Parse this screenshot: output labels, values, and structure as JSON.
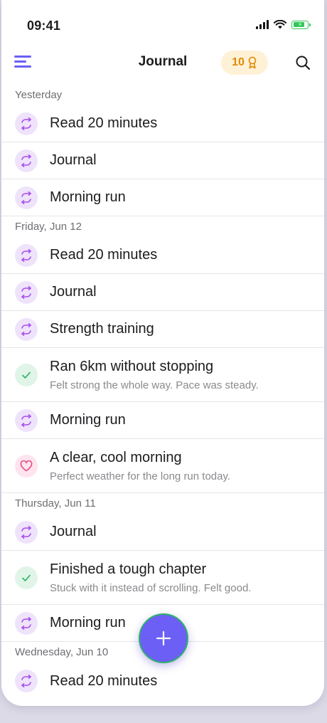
{
  "status_bar": {
    "time": "09:41",
    "battery_level": 0.8,
    "battery_color": "#34c759"
  },
  "header": {
    "title": "Journal",
    "points": "10",
    "accent_color": "#6b5ff5",
    "icons": {
      "menu": "hamburger-menu-icon",
      "points": "award-ribbon-icon",
      "search": "search-icon"
    }
  },
  "sections": [
    {
      "label": "Yesterday",
      "entries": [
        {
          "type": "habit",
          "title": "Read 20 minutes"
        },
        {
          "type": "habit",
          "title": "Journal"
        },
        {
          "type": "habit",
          "title": "Morning run"
        }
      ]
    },
    {
      "label": "Friday, Jun 12",
      "entries": [
        {
          "type": "habit",
          "title": "Read 20 minutes"
        },
        {
          "type": "habit",
          "title": "Journal"
        },
        {
          "type": "habit",
          "title": "Strength training"
        },
        {
          "type": "win",
          "title": "Ran 6km without stopping",
          "subtitle": "Felt strong the whole way. Pace was steady."
        },
        {
          "type": "habit",
          "title": "Morning run"
        },
        {
          "type": "grateful",
          "title": "A clear, cool morning",
          "subtitle": "Perfect weather for the long run today."
        }
      ]
    },
    {
      "label": "Thursday, Jun 11",
      "entries": [
        {
          "type": "habit",
          "title": "Journal"
        },
        {
          "type": "win",
          "title": "Finished a tough chapter",
          "subtitle": "Stuck with it instead of scrolling. Felt good."
        },
        {
          "type": "habit",
          "title": "Morning run"
        }
      ]
    },
    {
      "label": "Wednesday, Jun 10",
      "entries": [
        {
          "type": "habit",
          "title": "Read 20 minutes"
        }
      ]
    }
  ],
  "entry_icons": {
    "habit": "repeat-icon",
    "win": "checkmark-icon",
    "grateful": "heart-icon"
  },
  "entry_colors": {
    "habit": "#a64df0",
    "win": "#2fb36a",
    "grateful": "#e84c86"
  },
  "fab": {
    "icon": "plus-icon",
    "color": "#6b5ff5"
  }
}
